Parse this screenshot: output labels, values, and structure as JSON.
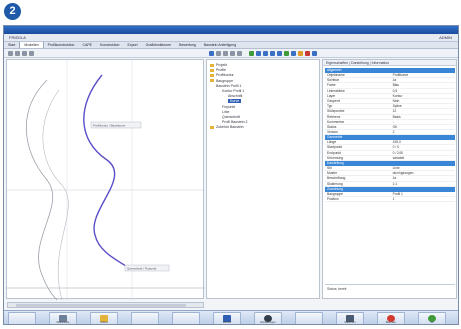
{
  "badge": "2",
  "window": {
    "app_name": "FRIEDLA",
    "user_label": "ADMIN"
  },
  "menu": {
    "items": [
      "Start",
      "Modellen",
      "Profilkonstruktion",
      "CAPE",
      "Konstruktion",
      "Export",
      "Grafikfunktionen",
      "Bewertung",
      "Baustein Anfertigung"
    ],
    "active_index": 1
  },
  "drawing": {
    "label_top": "Profilkontur / Basiskurve",
    "label_bottom": "Querschnitt / Fixpunkt"
  },
  "tree": {
    "items": [
      {
        "label": "Projekt",
        "indent": 0,
        "folder": true
      },
      {
        "label": "Profile",
        "indent": 0,
        "folder": true
      },
      {
        "label": "Profilkontur",
        "indent": 0,
        "folder": true
      },
      {
        "label": "Baugruppe",
        "indent": 0,
        "folder": true
      },
      {
        "label": "Baustein Profil 1",
        "indent": 1,
        "folder": false
      },
      {
        "label": "Kontur Profil 1",
        "indent": 2,
        "folder": false
      },
      {
        "label": "Abschnitt",
        "indent": 3,
        "folder": false
      },
      {
        "label": "Kurve",
        "indent": 3,
        "folder": false,
        "selected": true
      },
      {
        "label": "Fixpunkt",
        "indent": 2,
        "folder": false
      },
      {
        "label": "Linie",
        "indent": 2,
        "folder": false
      },
      {
        "label": "Querschnitt",
        "indent": 2,
        "folder": false
      },
      {
        "label": "Profil Baustein 2",
        "indent": 2,
        "folder": false
      },
      {
        "label": "Zubehör Baustein",
        "indent": 0,
        "folder": true
      }
    ]
  },
  "properties": {
    "tabs": "Eigenschaften | Darstellung | Information",
    "sections": [
      {
        "title": "Allgemein",
        "rows": [
          [
            "Objektname",
            "Profilkurve"
          ],
          [
            "Sichtbar",
            "Ja"
          ],
          [
            "Farbe",
            "Blau"
          ],
          [
            "Linienstärke",
            "0,5"
          ],
          [
            "Layer",
            "Kontur"
          ],
          [
            "Gesperrt",
            "Nein"
          ],
          [
            "Typ",
            "Spline"
          ],
          [
            "Stützpunkte",
            "12"
          ],
          [
            "Referenz",
            "Basis"
          ],
          [
            "Kommentar",
            "-"
          ],
          [
            "Status",
            "OK"
          ],
          [
            "Version",
            "2"
          ]
        ]
      },
      {
        "title": "Geometrie",
        "rows": [
          [
            "Länge",
            "245,0"
          ],
          [
            "Startpunkt",
            "0 / 0"
          ],
          [
            "Endpunkt",
            "0 / 245"
          ],
          [
            "Krümmung",
            "variabel"
          ]
        ]
      },
      {
        "title": "Darstellung",
        "rows": [
          [
            "Stil",
            "Linie"
          ],
          [
            "Muster",
            "durchgezogen"
          ],
          [
            "Beschriftung",
            "Ja"
          ],
          [
            "Skalierung",
            "1:1"
          ]
        ]
      },
      {
        "title": "Zuordnung",
        "rows": [
          [
            "Baugruppe",
            "Profil 1"
          ],
          [
            "Position",
            "1"
          ]
        ]
      }
    ],
    "footer": "Status: bereit"
  },
  "taskbar": {
    "buttons": [
      {
        "label": "",
        "glyph": "blank-icon"
      },
      {
        "label": "Dokumente",
        "glyph": "document-icon"
      },
      {
        "label": "Ordner",
        "glyph": "folder-icon"
      },
      {
        "label": "",
        "glyph": "blank-icon"
      },
      {
        "label": "",
        "glyph": "blank-icon"
      },
      {
        "label": "Monitor",
        "glyph": "monitor-icon"
      },
      {
        "label": "Einstellungen",
        "glyph": "gear-icon"
      },
      {
        "label": "",
        "glyph": "blank-icon"
      },
      {
        "label": "Speichern",
        "glyph": "save-icon"
      },
      {
        "label": "Beenden",
        "glyph": "cancel-icon"
      },
      {
        "label": "OK",
        "glyph": "ok-icon"
      }
    ]
  },
  "colors": {
    "accent": "#2f5fb4",
    "curve": "#5a4fc8",
    "section": "#3a86d6"
  }
}
